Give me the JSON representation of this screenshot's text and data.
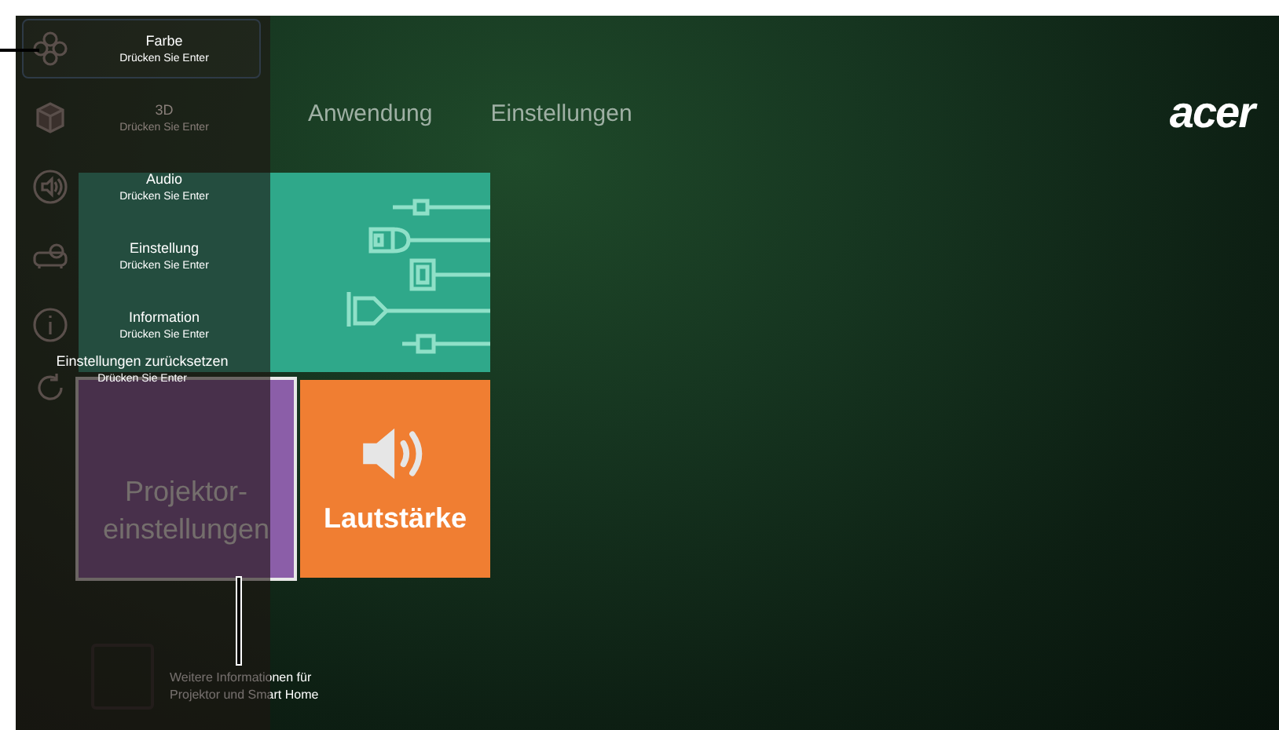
{
  "menu": {
    "items": [
      {
        "kind": "palette",
        "title": "Farbe",
        "subtitle": "Drücken Sie Enter",
        "selected": true,
        "disabled": false
      },
      {
        "kind": "cube",
        "title": "3D",
        "subtitle": "Drücken Sie Enter",
        "selected": false,
        "disabled": true
      },
      {
        "kind": "audio",
        "title": "Audio",
        "subtitle": "Drücken Sie Enter",
        "selected": false,
        "disabled": false
      },
      {
        "kind": "projector",
        "title": "Einstellung",
        "subtitle": "Drücken Sie Enter",
        "selected": false,
        "disabled": false
      },
      {
        "kind": "info",
        "title": "Information",
        "subtitle": "Drücken Sie Enter",
        "selected": false,
        "disabled": false
      },
      {
        "kind": "reset",
        "title": "Einstellungen zurücksetzen",
        "subtitle": "Drücken Sie Enter",
        "selected": false,
        "disabled": false
      }
    ]
  },
  "tabs": [
    {
      "label": "Anwendung"
    },
    {
      "label": "Einstellungen"
    }
  ],
  "logo": "acer",
  "tiles": [
    {
      "kind": "cables",
      "selected": false
    },
    {
      "kind": "projector-settings",
      "label": "Projektor-\neinstellungen",
      "selected": true
    },
    {
      "kind": "volume",
      "label": "Lautstärke",
      "selected": false
    }
  ],
  "info_tile": {
    "text": "Weitere Informationen für\nProjektor und Smart Home"
  }
}
